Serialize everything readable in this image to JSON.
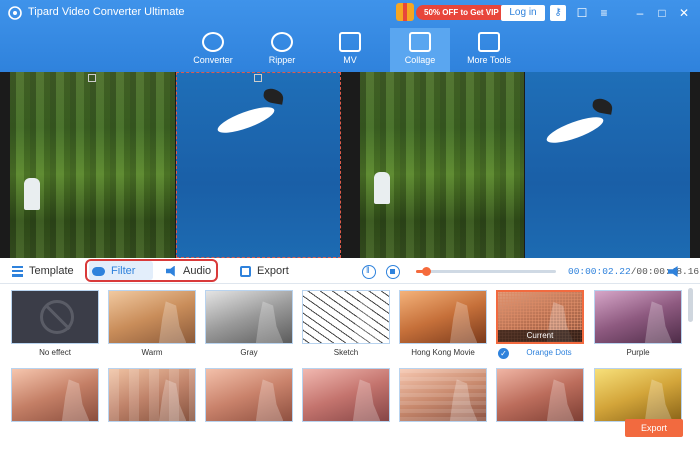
{
  "app": {
    "title": "Tipard Video Converter Ultimate",
    "promo": "50% OFF to Get VIP",
    "login": "Log in"
  },
  "nav": [
    {
      "label": "Converter",
      "icon": "converter-icon"
    },
    {
      "label": "Ripper",
      "icon": "ripper-icon"
    },
    {
      "label": "MV",
      "icon": "mv-icon"
    },
    {
      "label": "Collage",
      "icon": "collage-icon",
      "active": true
    },
    {
      "label": "More Tools",
      "icon": "toolbox-icon"
    }
  ],
  "tabs": {
    "template": "Template",
    "filter": "Filter",
    "audio": "Audio",
    "export": "Export"
  },
  "player": {
    "current_time": "00:00:02.22",
    "total_time": "/00:00:48.16",
    "progress": 0.07
  },
  "filters": [
    {
      "name": "No effect"
    },
    {
      "name": "Warm"
    },
    {
      "name": "Gray"
    },
    {
      "name": "Sketch"
    },
    {
      "name": "Hong Kong Movie"
    },
    {
      "name": "Orange Dots",
      "selected": true,
      "badge": "Current"
    },
    {
      "name": "Purple"
    }
  ],
  "export_button": "Export",
  "colors": {
    "accent": "#2f82dc",
    "orange": "#f26a3f",
    "highlight_box": "#d93a3a"
  }
}
